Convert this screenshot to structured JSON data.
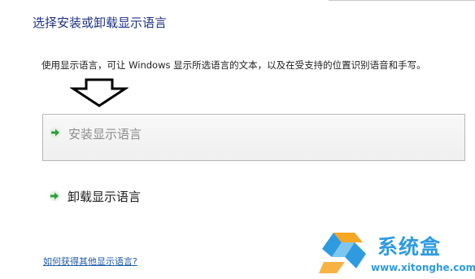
{
  "header": {
    "title": "选择安装或卸载显示语言"
  },
  "description": "使用显示语言，可让 Windows 显示所选语言的文本，以及在受支持的位置识别语音和手写。",
  "options": {
    "install_label": "安装显示语言",
    "uninstall_label": "卸载显示语言"
  },
  "footer": {
    "help_link": "如何获得其他显示语言?"
  },
  "watermark": {
    "name": "系统盒",
    "url": "www.xitonghe.com"
  },
  "colors": {
    "title": "#1e3287",
    "link": "#1e5aa8",
    "accent_green": "#2f9d3a",
    "watermark": "#2e9be0"
  },
  "icons": {
    "option_arrow": "green-right-arrow-icon",
    "pointer": "down-arrow-outline-icon"
  }
}
